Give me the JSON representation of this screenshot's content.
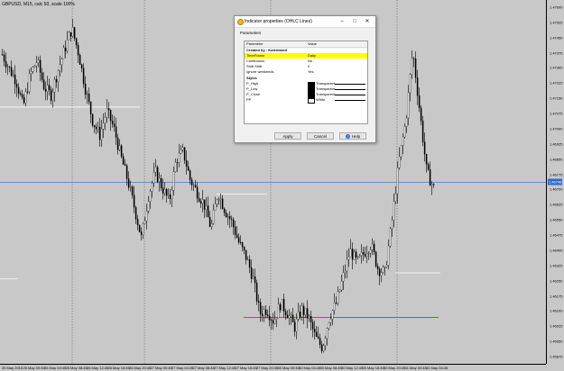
{
  "chart": {
    "title": "GBPUSD, M15, calc 50, scale 100%",
    "price_labels": [
      "1.47600",
      "1.47525",
      "1.47450",
      "1.47375",
      "1.47300",
      "1.47225",
      "1.47150",
      "1.47075",
      "1.47000",
      "1.46925",
      "1.46850",
      "1.46775",
      "1.46700",
      "1.46625",
      "1.46550",
      "1.46475",
      "1.46400",
      "1.46325",
      "1.46250",
      "1.46175",
      "1.46100",
      "1.46025",
      "1.45950",
      "1.45875"
    ],
    "current_price": "1.46748",
    "time_labels": [
      "26 May 2016",
      "26 May 00:45",
      "26 May 04:45",
      "26 May 08:45",
      "26 May 12:45",
      "26 May 16:45",
      "26 May 20:45",
      "27 May 00:45",
      "27 May 04:45",
      "27 May 08:45",
      "27 May 12:45",
      "27 May 16:45",
      "27 May 20:45",
      "30 May 00:45",
      "30 May 04:45",
      "30 May 08:45",
      "30 May 12:45",
      "30 May 16:45",
      "30 May 20:45",
      "31 May 00:45",
      "31 May 04:45"
    ],
    "colors": {
      "background": "#c8c8c8",
      "candle": "#000000",
      "current_price_line": "#2a6bd6",
      "low_line": "#c000c0",
      "level_line": "#ffffff"
    }
  },
  "chart_data": {
    "type": "candlestick",
    "title": "GBPUSD, M15, calc 50, scale 100%",
    "ylim": [
      1.4585,
      1.4765
    ],
    "current_price": 1.46748,
    "closes": [
      1.4738,
      1.4731,
      1.4725,
      1.4712,
      1.4728,
      1.4735,
      1.4722,
      1.4718,
      1.473,
      1.4741,
      1.4751,
      1.4738,
      1.472,
      1.4705,
      1.4698,
      1.471,
      1.4702,
      1.4688,
      1.4676,
      1.4662,
      1.4647,
      1.4668,
      1.468,
      1.4672,
      1.4665,
      1.4686,
      1.469,
      1.4676,
      1.467,
      1.4664,
      1.4652,
      1.467,
      1.4661,
      1.4655,
      1.4645,
      1.4638,
      1.4628,
      1.461,
      1.4612,
      1.4606,
      1.4615,
      1.461,
      1.4603,
      1.4612,
      1.4608,
      1.4598,
      1.4593,
      1.4608,
      1.4615,
      1.4628,
      1.4641,
      1.4635,
      1.464,
      1.4644,
      1.4632,
      1.463,
      1.4655,
      1.4685,
      1.4705,
      1.474,
      1.471,
      1.468,
      1.4672
    ]
  },
  "dialog": {
    "title": "Indicator properties (OHLC Lines)",
    "tab": "Parameters",
    "table_header": {
      "name": "Parameter",
      "value": "Value"
    },
    "rows": [
      {
        "name": "Created by : Kolenbsnd",
        "value": "",
        "kind": "section"
      },
      {
        "name": "TimeFrame",
        "value": "Daily",
        "kind": "highlight"
      },
      {
        "name": "Continuous",
        "value": "No",
        "kind": "normal"
      },
      {
        "name": "Shift Shift",
        "value": "0",
        "kind": "normal"
      },
      {
        "name": "Ignore weekends",
        "value": "Yes",
        "kind": "normal"
      }
    ],
    "styles_label": "Styles",
    "styles": [
      {
        "name": "P_High",
        "value": "Transparent",
        "swatch": "black"
      },
      {
        "name": "P_Low",
        "value": "Transparent",
        "swatch": "black"
      },
      {
        "name": "P_Close",
        "value": "Transparent",
        "swatch": "black"
      },
      {
        "name": "PP",
        "value": "White",
        "swatch": "white"
      }
    ],
    "buttons": {
      "apply": "Apply",
      "cancel": "Cancel",
      "help": "Help"
    },
    "window_buttons": {
      "minimize": "–",
      "maximize": "□",
      "close": "✕"
    }
  }
}
